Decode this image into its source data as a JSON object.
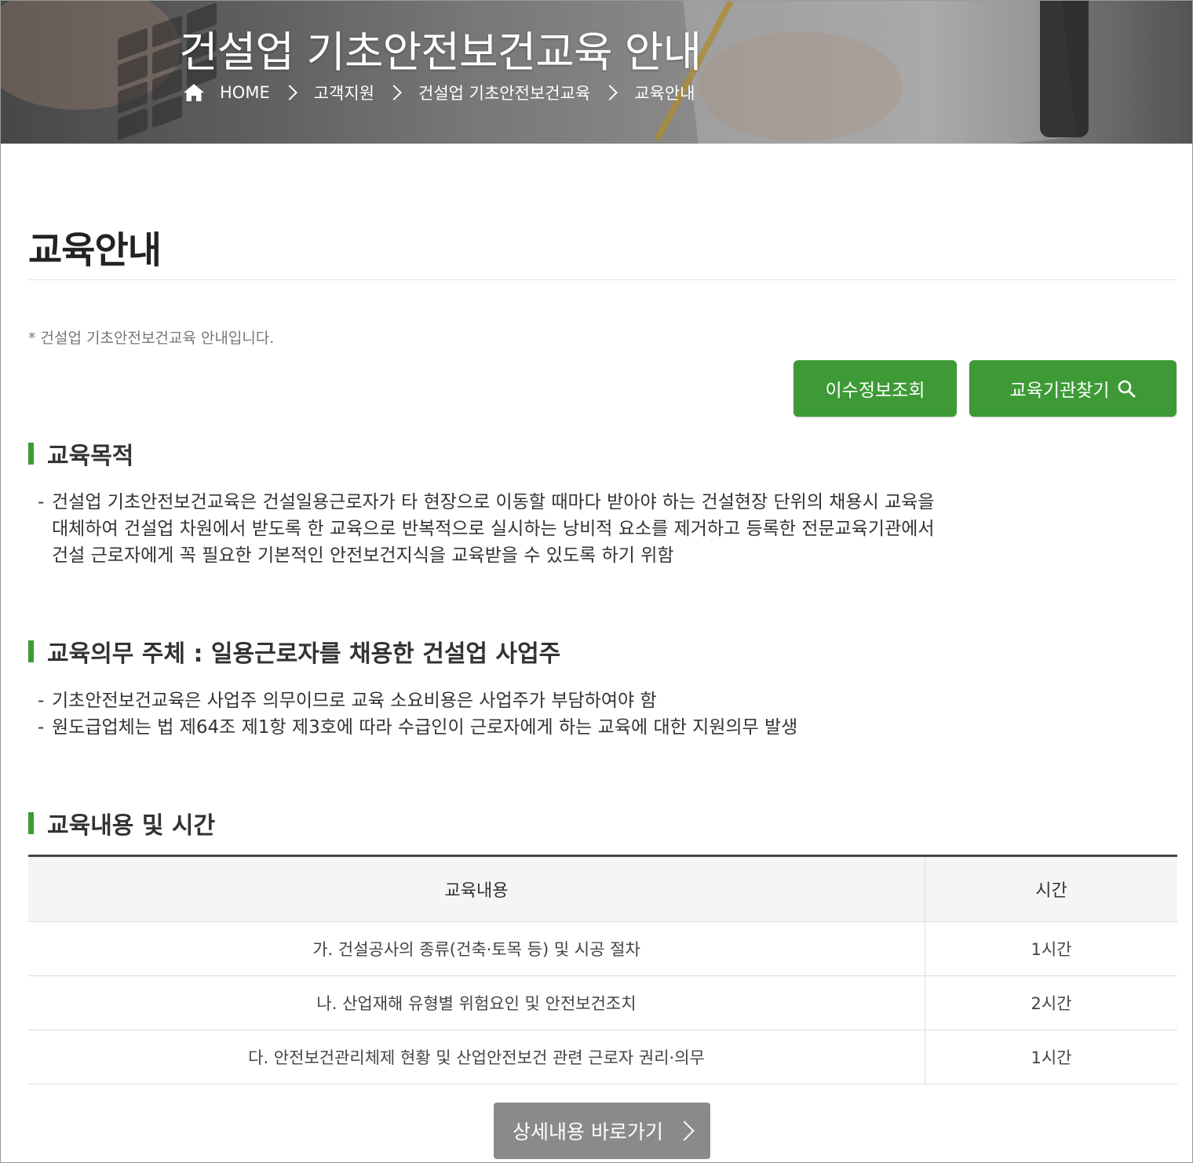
{
  "hero": {
    "title": "건설업 기초안전보건교육 안내",
    "breadcrumb": [
      "HOME",
      "고객지원",
      "건설업 기초안전보건교육",
      "교육안내"
    ]
  },
  "page": {
    "title": "교육안내",
    "intro": "* 건설업 기초안전보건교육 안내입니다."
  },
  "actions": {
    "lookup_label": "이수정보조회",
    "find_label": "교육기관찾기"
  },
  "sections": {
    "purpose": {
      "heading": "교육목적",
      "lines": [
        "건설업 기초안전보건교육은 건설일용근로자가 타 현장으로 이동할 때마다 받아야 하는 건설현장 단위의 채용시 교육을",
        "대체하여 건설업 차원에서 받도록 한 교육으로 반복적으로 실시하는 낭비적 요소를 제거하고 등록한 전문교육기관에서",
        "건설 근로자에게 꼭 필요한 기본적인 안전보건지식을 교육받을 수 있도록 하기 위함"
      ]
    },
    "duty": {
      "heading": "교육의무 주체 : 일용근로자를 채용한 건설업 사업주",
      "items": [
        "기초안전보건교육은 사업주 의무이므로 교육 소요비용은 사업주가 부담하여야 함",
        "원도급업체는 법 제64조 제1항 제3호에 따라 수급인이 근로자에게 하는 교육에 대한 지원의무 발생"
      ]
    },
    "content": {
      "heading": "교육내용 및 시간",
      "columns": [
        "교육내용",
        "시간"
      ],
      "rows": [
        {
          "content": "가. 건설공사의 종류(건축·토목 등) 및 시공 절차",
          "time": "1시간"
        },
        {
          "content": "나. 산업재해 유형별 위험요인 및 안전보건조치",
          "time": "2시간"
        },
        {
          "content": "다. 안전보건관리체제 현황 및 산업안전보건 관련 근로자 권리·의무",
          "time": "1시간"
        }
      ]
    }
  },
  "detail_button": "상세내용 바로가기",
  "colors": {
    "accent": "#3d9a36",
    "detail_button": "#8a8a8a"
  }
}
